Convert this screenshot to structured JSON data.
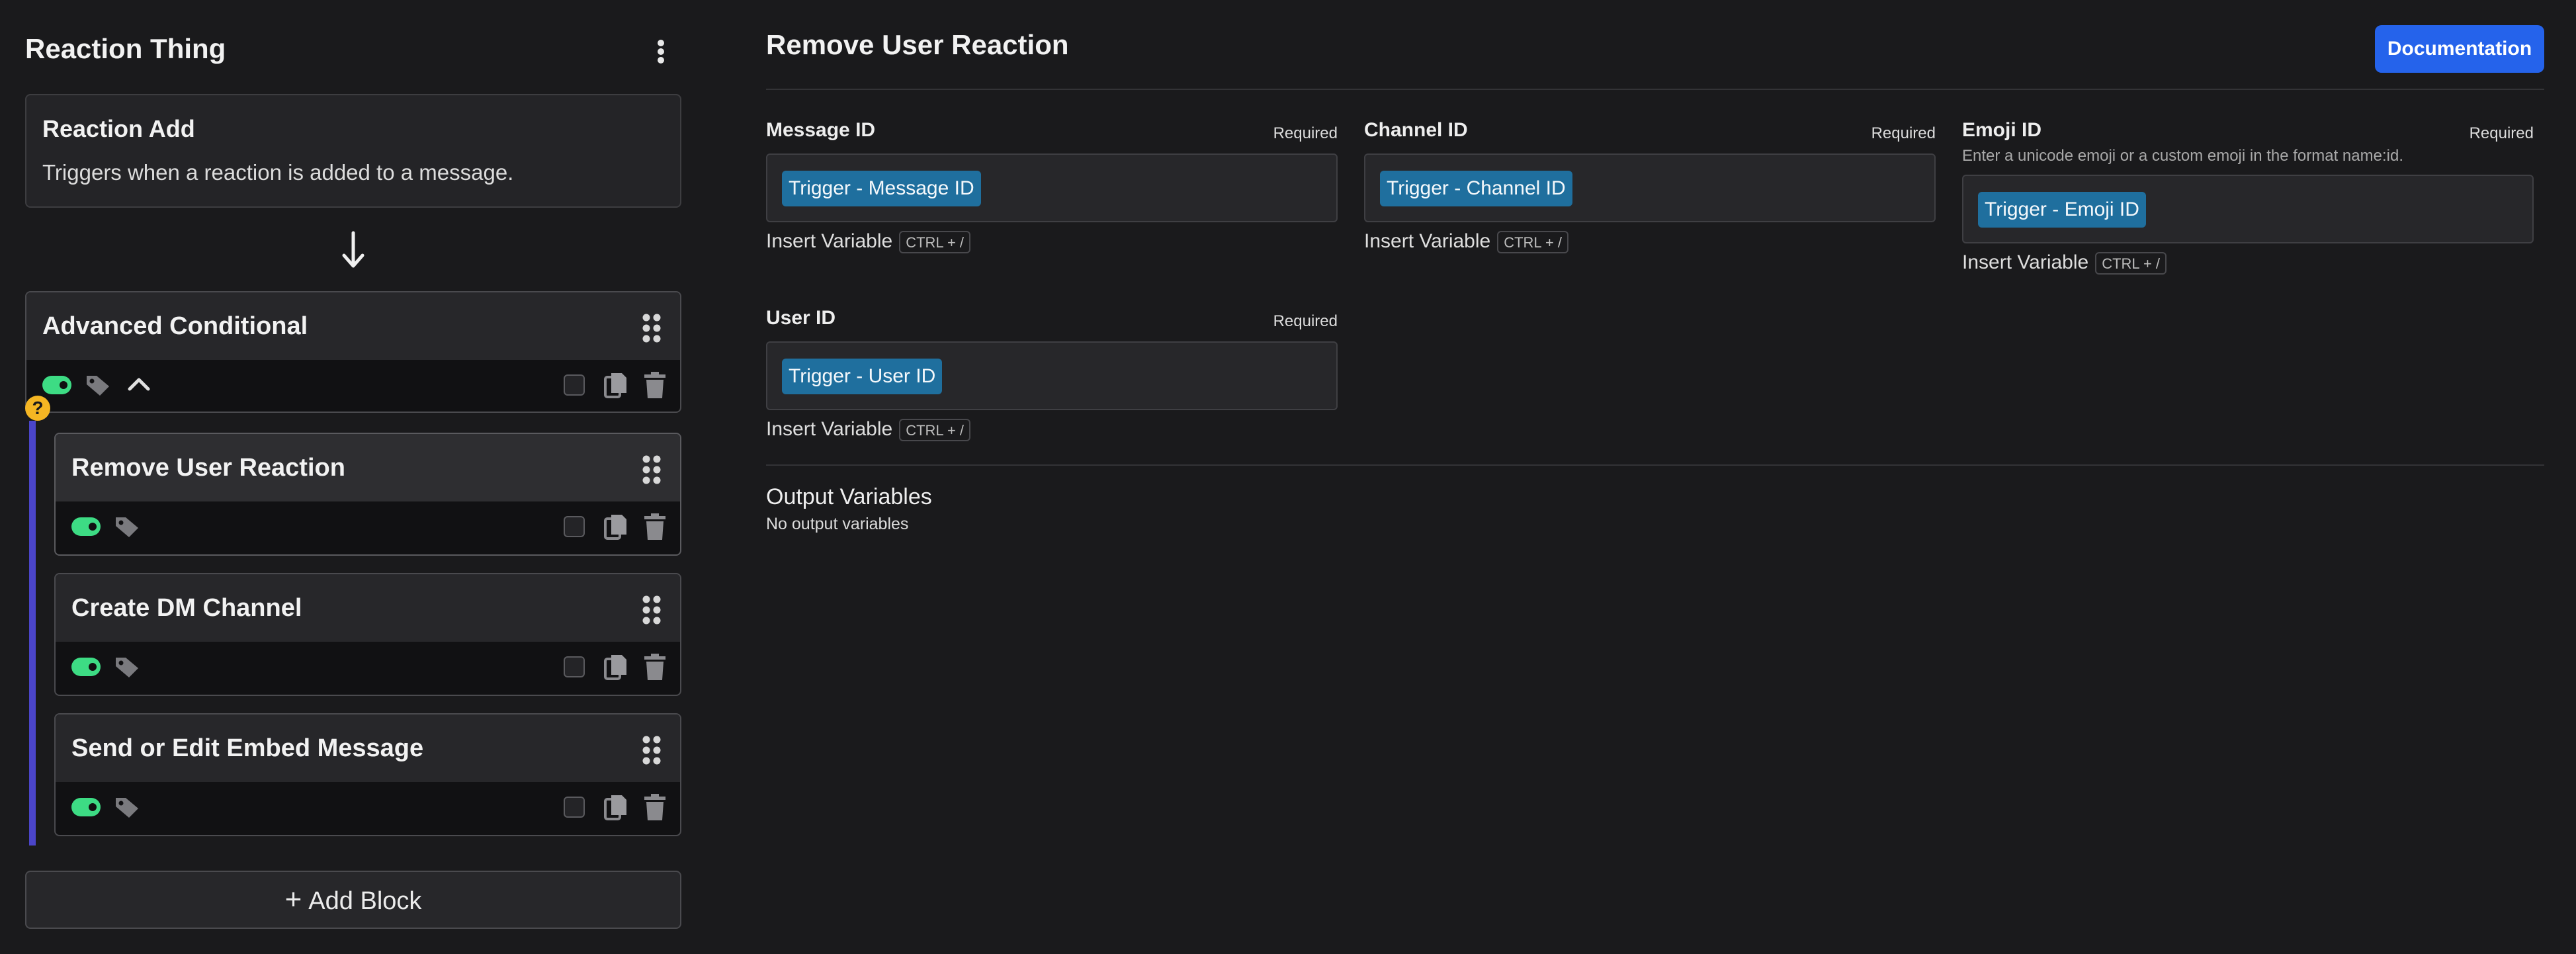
{
  "sidebar": {
    "title": "Reaction Thing",
    "trigger": {
      "title": "Reaction Add",
      "description": "Triggers when a reaction is added to a message."
    },
    "blocks": [
      {
        "title": "Advanced Conditional",
        "enabled": true
      },
      {
        "title": "Remove User Reaction",
        "enabled": true,
        "selected": true
      },
      {
        "title": "Create DM Channel",
        "enabled": true
      },
      {
        "title": "Send or Edit Embed Message",
        "enabled": true
      }
    ],
    "help_badge": "?",
    "add_block_label": "Add Block"
  },
  "editor": {
    "title": "Remove User Reaction",
    "documentation_label": "Documentation",
    "required_label": "Required",
    "insert_variable_label": "Insert Variable",
    "shortcut": "CTRL + /",
    "fields": {
      "message_id": {
        "label": "Message ID",
        "value": "Trigger - Message ID"
      },
      "channel_id": {
        "label": "Channel ID",
        "value": "Trigger - Channel ID"
      },
      "emoji_id": {
        "label": "Emoji ID",
        "hint": "Enter a unicode emoji or a custom emoji in the format name:id.",
        "value": "Trigger - Emoji ID"
      },
      "user_id": {
        "label": "User ID",
        "value": "Trigger - User ID"
      }
    },
    "output": {
      "title": "Output Variables",
      "empty_text": "No output variables"
    }
  },
  "colors": {
    "background": "#1a1a1c",
    "accent": "#2563eb",
    "toggle_on": "#3ddc84",
    "chip": "#1f6f9e",
    "rail": "#4b45c9",
    "help": "#f5b623"
  }
}
